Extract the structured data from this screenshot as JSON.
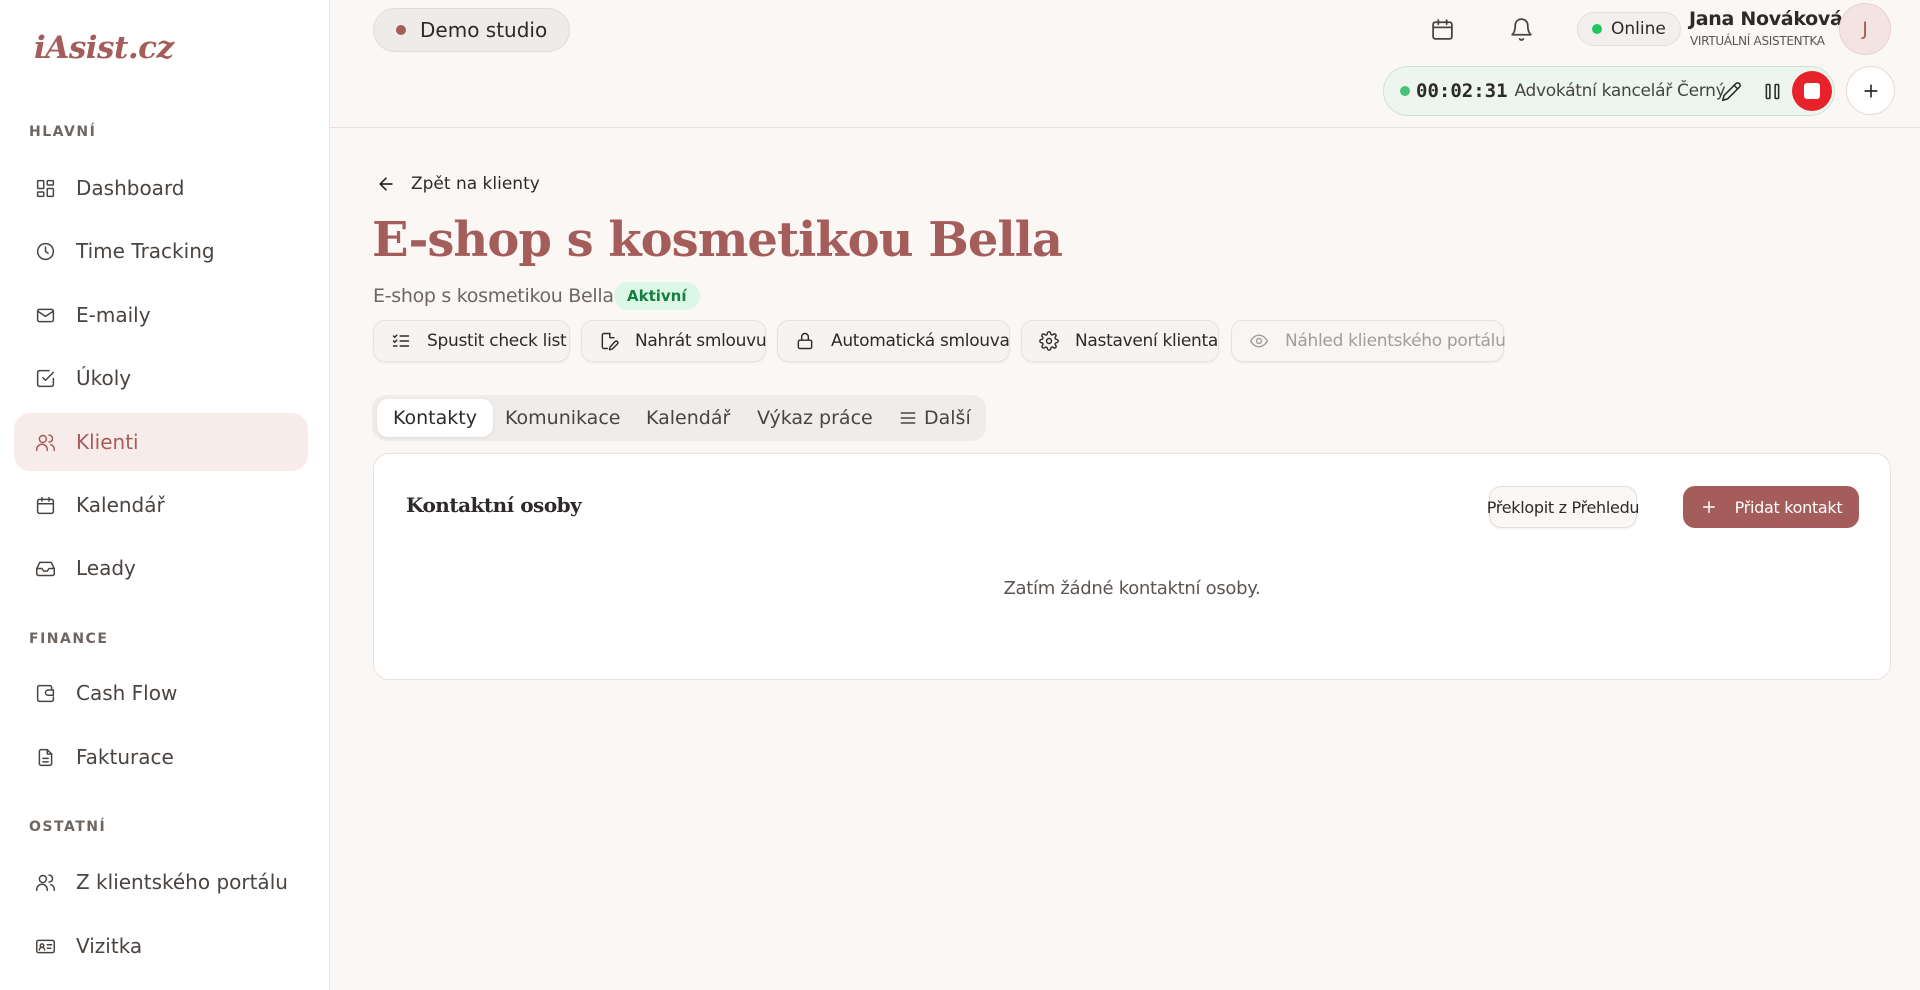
{
  "sidebar": {
    "logo": "iAsist.cz",
    "sections": [
      {
        "title": "HLAVNÍ"
      },
      {
        "title": "FINANCE"
      },
      {
        "title": "OSTATNÍ"
      }
    ],
    "items": [
      {
        "label": "Dashboard",
        "icon": "dashboard-icon"
      },
      {
        "label": "Time Tracking",
        "icon": "clock-icon"
      },
      {
        "label": "E-maily",
        "icon": "mail-icon"
      },
      {
        "label": "Úkoly",
        "icon": "checkbox-icon"
      },
      {
        "label": "Klienti",
        "icon": "users-icon",
        "active": true
      },
      {
        "label": "Kalendář",
        "icon": "calendar-icon"
      },
      {
        "label": "Leady",
        "icon": "inbox-icon"
      },
      {
        "label": "Cash Flow",
        "icon": "wallet-icon"
      },
      {
        "label": "Fakturace",
        "icon": "document-icon"
      },
      {
        "label": "Z klientského portálu",
        "icon": "users-icon"
      },
      {
        "label": "Vizitka",
        "icon": "id-card-icon"
      }
    ]
  },
  "header": {
    "studio": "Demo studio",
    "status": "Online",
    "user_name": "Jana Nováková",
    "user_role": "VIRTUÁLNÍ ASISTENTKA",
    "avatar_initial": "J",
    "timer": {
      "time": "00:02:31",
      "client": "Advokátní kancelář Černý"
    }
  },
  "main": {
    "back_label": "Zpět na klienty",
    "title": "E-shop s kosmetikou Bella",
    "subtitle": "E-shop s kosmetikou Bella",
    "status_badge": "Aktivní",
    "actions": [
      {
        "label": "Spustit check list",
        "icon": "checklist-icon"
      },
      {
        "label": "Nahrát smlouvu",
        "icon": "file-edit-icon"
      },
      {
        "label": "Automatická smlouva",
        "icon": "lock-icon"
      },
      {
        "label": "Nastavení klienta",
        "icon": "gear-icon"
      },
      {
        "label": "Náhled klientského portálu",
        "icon": "eye-icon",
        "disabled": true
      }
    ],
    "tabs": [
      {
        "label": "Kontakty",
        "active": true
      },
      {
        "label": "Komunikace"
      },
      {
        "label": "Kalendář"
      },
      {
        "label": "Výkaz práce"
      },
      {
        "label": "Další"
      }
    ],
    "card": {
      "title": "Kontaktní osoby",
      "secondary_button": "Překlopit z Přehledu",
      "primary_button": "Přidat kontakt",
      "empty_text": "Zatím žádné kontaktní osoby."
    }
  },
  "colors": {
    "brand": "#a45d5a",
    "success": "#22c55e",
    "stop": "#e8222b"
  }
}
